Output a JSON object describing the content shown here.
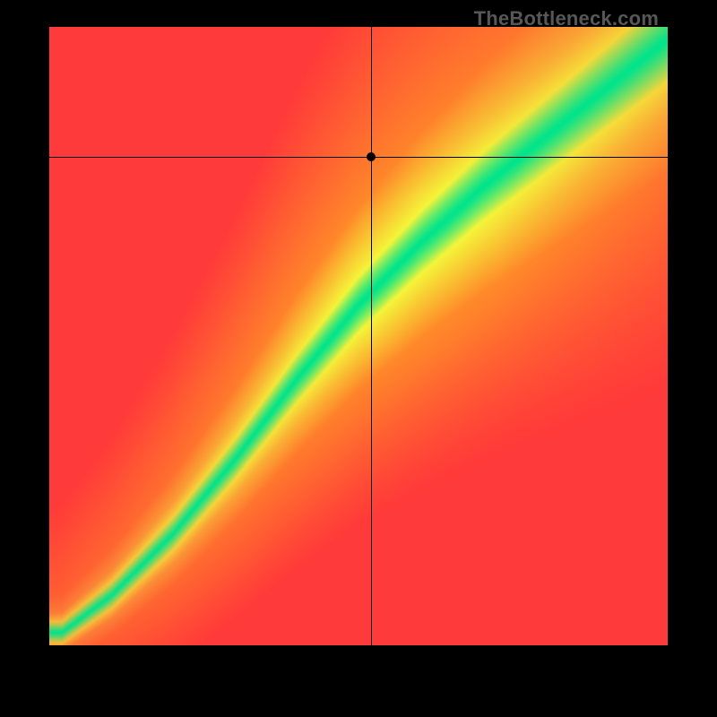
{
  "watermark": "TheBottleneck.com",
  "chart_data": {
    "type": "heatmap",
    "title": "",
    "xlabel": "",
    "ylabel": "",
    "xlim": [
      0,
      100
    ],
    "ylim": [
      0,
      100
    ],
    "marker": {
      "x": 52,
      "y": 79
    },
    "crosshair": {
      "x": 52,
      "y": 79
    },
    "green_ridge": [
      {
        "x": 2,
        "y": 2
      },
      {
        "x": 10,
        "y": 8
      },
      {
        "x": 20,
        "y": 18
      },
      {
        "x": 30,
        "y": 30
      },
      {
        "x": 40,
        "y": 43
      },
      {
        "x": 50,
        "y": 55
      },
      {
        "x": 60,
        "y": 65
      },
      {
        "x": 70,
        "y": 74
      },
      {
        "x": 80,
        "y": 82
      },
      {
        "x": 90,
        "y": 90
      },
      {
        "x": 100,
        "y": 98
      }
    ],
    "color_stops": {
      "optimal": "#00e58c",
      "near": "#f5f53a",
      "far": "#ff3a3a",
      "mid": "#ff8a2a"
    },
    "description": "Heatmap showing bottleneck match. Green S-curve diagonal band = balanced; transitions through yellow/orange to red away from the band. Black crosshair marks a point at roughly (52, 79) which sits above the green band in the yellow/orange region."
  }
}
